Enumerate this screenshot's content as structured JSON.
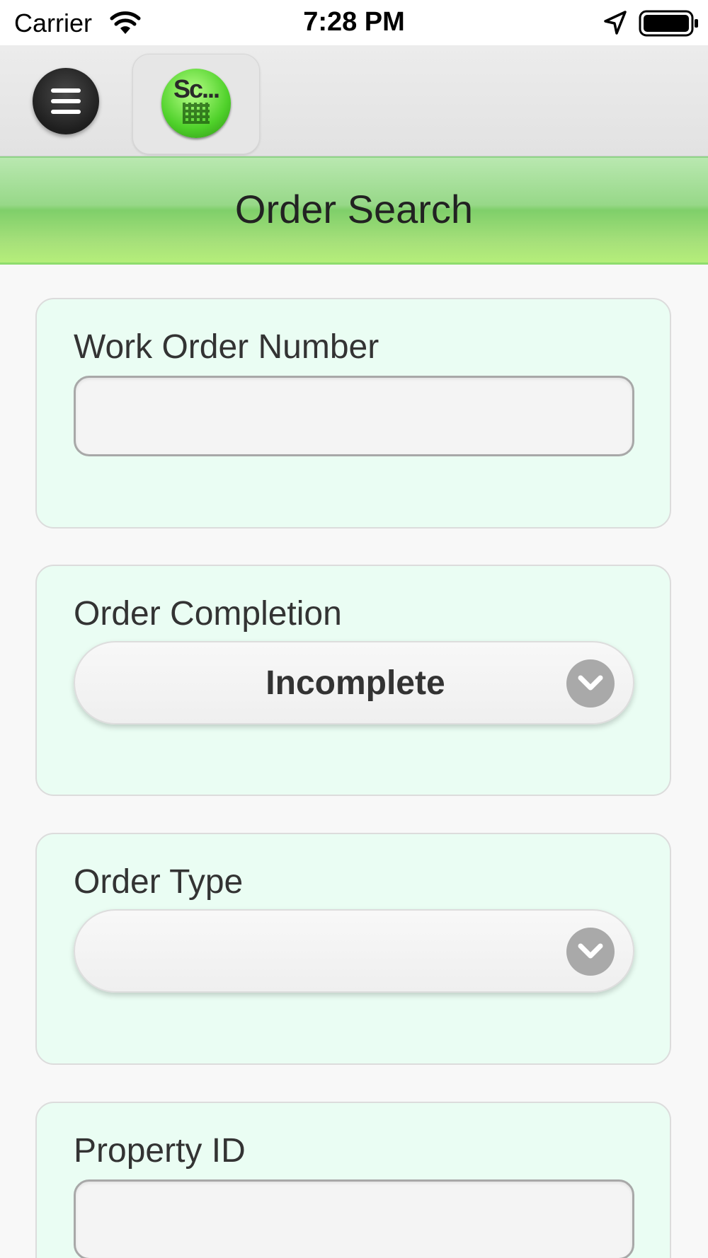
{
  "status_bar": {
    "carrier": "Carrier",
    "time": "7:28 PM",
    "icons": [
      "wifi-icon",
      "location-arrow-icon",
      "battery-icon"
    ]
  },
  "toolbar": {
    "menu_icon": "hamburger-menu-icon",
    "logo_text": "Sc..."
  },
  "header": {
    "title": "Order Search"
  },
  "form": {
    "work_order": {
      "label": "Work Order Number",
      "value": ""
    },
    "order_completion": {
      "label": "Order Completion",
      "selected": "Incomplete"
    },
    "order_type": {
      "label": "Order Type",
      "selected": ""
    },
    "property_id": {
      "label": "Property ID",
      "value": ""
    }
  },
  "colors": {
    "header_green": "#97d888",
    "card_background": "#eafdf3",
    "chevron_gray": "#a9a9a9"
  }
}
